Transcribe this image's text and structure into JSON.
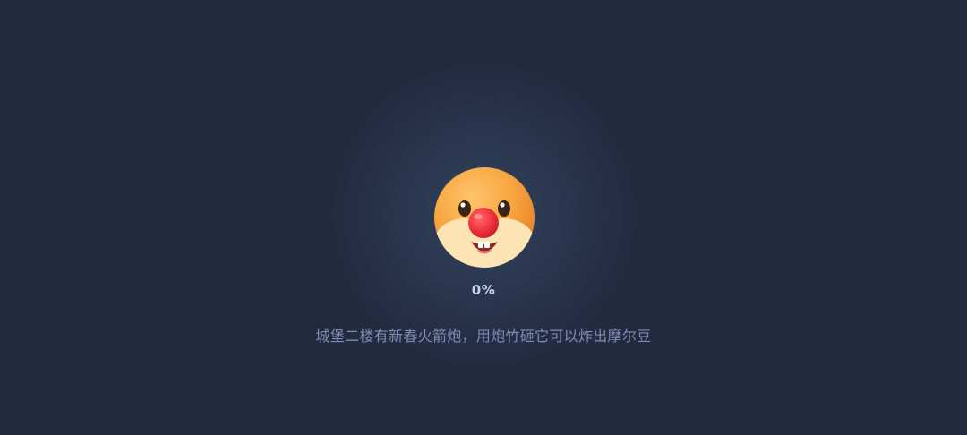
{
  "loading": {
    "mascot_icon": "hamster-face-icon",
    "progress_text": "0%",
    "progress_value": 0,
    "tip_text": "城堡二楼有新春火箭炮，用炮竹砸它可以炸出摩尔豆"
  },
  "colors": {
    "background": "#232a3e",
    "progress_text": "#c8d2ee",
    "tip_text": "#7e8cb6",
    "mascot_orange": "#f39a3a",
    "mascot_nose": "#f2353f"
  }
}
